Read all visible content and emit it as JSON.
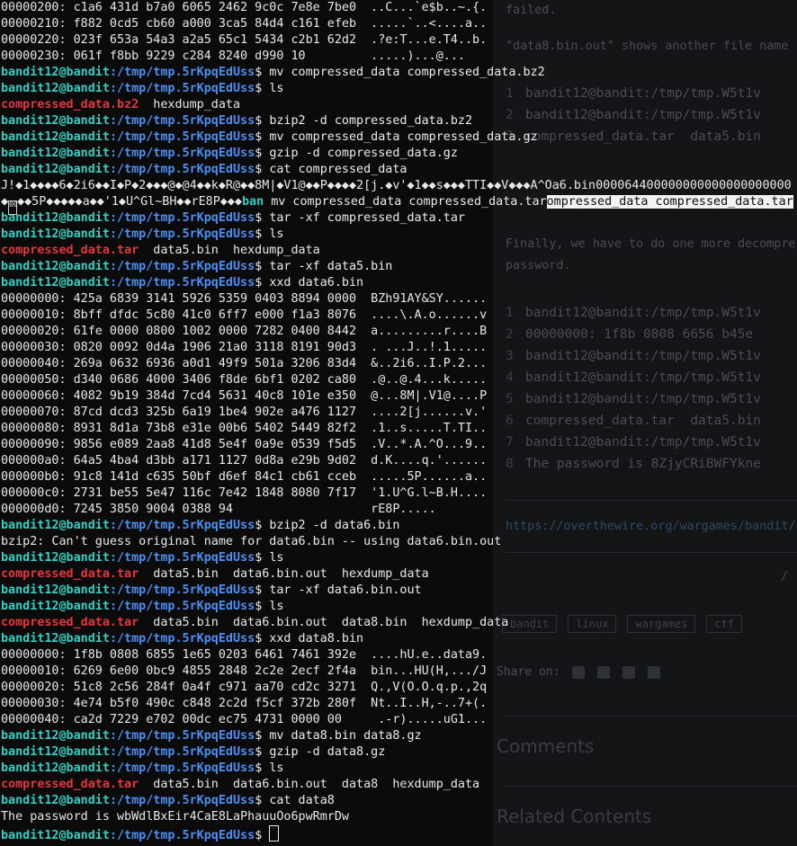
{
  "background_page": {
    "text_a": "failed.",
    "text_b": "\"data8.bin.out\" shows another file name",
    "code_block_1": [
      {
        "n": "1",
        "t": "bandit12@bandit:/tmp/tmp.W5t1v"
      },
      {
        "n": "2",
        "t": "bandit12@bandit:/tmp/tmp.W5t1v"
      },
      {
        "n": "3",
        "t": "compressed_data.tar  data5.bin"
      }
    ],
    "text_c": "Finally, we have to do one more decompre",
    "text_d": "password.",
    "code_block_2": [
      {
        "n": "1",
        "t": "bandit12@bandit:/tmp/tmp.W5t1v"
      },
      {
        "n": "2",
        "t": "00000000: 1f8b 0808 6656 b45e"
      },
      {
        "n": "3",
        "t": "bandit12@bandit:/tmp/tmp.W5t1v"
      },
      {
        "n": "4",
        "t": "bandit12@bandit:/tmp/tmp.W5t1v"
      },
      {
        "n": "5",
        "t": "bandit12@bandit:/tmp/tmp.W5t1v"
      },
      {
        "n": "6",
        "t": "compressed_data.tar  data5.bin"
      },
      {
        "n": "7",
        "t": "bandit12@bandit:/tmp/tmp.W5t1v"
      },
      {
        "n": "8",
        "t": "The password is 8ZjyCRiBWFYkne"
      }
    ],
    "link": "https://overthewire.org/wargames/bandit/",
    "slash": "/",
    "tags": [
      "bandit",
      "linux",
      "wargames",
      "ctf"
    ],
    "share_label": "Share on:",
    "comments_heading": "Comments",
    "related_heading": "Related Contents"
  },
  "prompt": {
    "user": "bandit12@bandit",
    "path": ":/tmp/tmp.5rKpqEdUss",
    "symbol": "$ "
  },
  "lines": [
    {
      "kind": "out",
      "text": "00000200: c1a6 431d b7a0 6065 2462 9c0c 7e8e 7be0  ..C...`e$b..~.{."
    },
    {
      "kind": "out",
      "text": "00000210: f882 0cd5 cb60 a000 3ca5 84d4 c161 efeb  .....`..<....a.."
    },
    {
      "kind": "out",
      "text": "00000220: 023f 653a 54a3 a2a5 65c1 5434 c2b1 62d2  .?e:T...e.T4..b."
    },
    {
      "kind": "out",
      "text": "00000230: 061f f8bb 9229 c284 8240 d990 10         .....)...@..."
    },
    {
      "kind": "cmd",
      "text": "mv compressed_data compressed_data.bz2"
    },
    {
      "kind": "cmd",
      "text": "ls"
    },
    {
      "kind": "ls",
      "red": "compressed_data.bz2",
      "rest": "  hexdump_data"
    },
    {
      "kind": "cmd",
      "text": "bzip2 -d compressed_data.bz2"
    },
    {
      "kind": "cmd",
      "text": "mv compressed_data compressed_data.gz"
    },
    {
      "kind": "cmd",
      "text": "gzip -d compressed_data.gz"
    },
    {
      "kind": "cmd",
      "text": "cat compressed_data"
    },
    {
      "kind": "out",
      "text": "J!◆1◆◆◆◆6◆2i6◆◆I◆P◆2◆◆◆@◆@4◆◆k◆R@◆◆8M|◆V1@◆◆P◆◆◆◆2[j.◆v'◆1◆◆s◆◆◆TTI◆◆V◆◆◆A^Oa6.bin000064400000000000000000000"
    },
    {
      "kind": "garbled",
      "pre": "◆",
      "box": "00",
      "mid": "◆◆5P◆◆◆◆◆a◆◆'1◆U^Gl~BH◆◆rE8P◆◆◆",
      "user2": "ban",
      "mid2": " mv compressed_data compressed_data.tar",
      "sel": "ompressed_data compressed_data.tar"
    },
    {
      "kind": "cmd",
      "text": "tar -xf compressed_data.tar"
    },
    {
      "kind": "cmd",
      "text": "ls"
    },
    {
      "kind": "ls",
      "red": "compressed_data.tar",
      "rest": "  data5.bin  hexdump_data"
    },
    {
      "kind": "cmd",
      "text": "tar -xf data5.bin"
    },
    {
      "kind": "cmd",
      "text": "xxd data6.bin"
    },
    {
      "kind": "out",
      "text": "00000000: 425a 6839 3141 5926 5359 0403 8894 0000  BZh91AY&SY......"
    },
    {
      "kind": "out",
      "text": "00000010: 8bff dfdc 5c80 41c0 6ff7 e000 f1a3 8076  ....\\.A.o......v"
    },
    {
      "kind": "out",
      "text": "00000020: 61fe 0000 0800 1002 0000 7282 0400 8442  a.........r....B"
    },
    {
      "kind": "out",
      "text": "00000030: 0820 0092 0d4a 1906 21a0 3118 8191 90d3  . ...J..!.1....."
    },
    {
      "kind": "out",
      "text": "00000040: 269a 0632 6936 a0d1 49f9 501a 3206 83d4  &..2i6..I.P.2..."
    },
    {
      "kind": "out",
      "text": "00000050: d340 0686 4000 3406 f8de 6bf1 0202 ca80  .@..@.4...k....."
    },
    {
      "kind": "out",
      "text": "00000060: 4082 9b19 384d 7cd4 5631 40c8 101e e350  @...8M|.V1@....P"
    },
    {
      "kind": "out",
      "text": "00000070: 87cd dcd3 325b 6a19 1be4 902e a476 1127  ....2[j......v.'"
    },
    {
      "kind": "out",
      "text": "00000080: 8931 8d1a 73b8 e31e 00b6 5402 5449 82f2  .1..s.....T.TI.."
    },
    {
      "kind": "out",
      "text": "00000090: 9856 e089 2aa8 41d8 5e4f 0a9e 0539 f5d5  .V..*.A.^O...9.."
    },
    {
      "kind": "out",
      "text": "000000a0: 64a5 4ba4 d3bb a171 1127 0d8a e29b 9d02  d.K....q.'......"
    },
    {
      "kind": "out",
      "text": "000000b0: 91c8 141d c635 50bf d6ef 84c1 cb61 cceb  .....5P......a.."
    },
    {
      "kind": "out",
      "text": "000000c0: 2731 be55 5e47 116c 7e42 1848 8080 7f17  '1.U^G.l~B.H...."
    },
    {
      "kind": "out",
      "text": "000000d0: 7245 3850 9004 0388 94                   rE8P....."
    },
    {
      "kind": "cmd",
      "text": "bzip2 -d data6.bin"
    },
    {
      "kind": "out",
      "text": "bzip2: Can't guess original name for data6.bin -- using data6.bin.out"
    },
    {
      "kind": "cmd",
      "text": "ls"
    },
    {
      "kind": "ls",
      "red": "compressed_data.tar",
      "rest": "  data5.bin  data6.bin.out  hexdump_data"
    },
    {
      "kind": "cmd",
      "text": "tar -xf data6.bin.out"
    },
    {
      "kind": "cmd",
      "text": "ls"
    },
    {
      "kind": "ls",
      "red": "compressed_data.tar",
      "rest": "  data5.bin  data6.bin.out  data8.bin  hexdump_data"
    },
    {
      "kind": "cmd",
      "text": "xxd data8.bin"
    },
    {
      "kind": "out",
      "text": "00000000: 1f8b 0808 6855 1e65 0203 6461 7461 392e  ....hU.e..data9."
    },
    {
      "kind": "out",
      "text": "00000010: 6269 6e00 0bc9 4855 2848 2c2e 2ecf 2f4a  bin...HU(H,.../J"
    },
    {
      "kind": "out",
      "text": "00000020: 51c8 2c56 284f 0a4f c971 aa70 cd2c 3271  Q.,V(O.O.q.p.,2q"
    },
    {
      "kind": "out",
      "text": "00000030: 4e74 b5f0 490c c848 2c2d f5cf 372b 280f  Nt..I..H,-..7+(."
    },
    {
      "kind": "out",
      "text": "00000040: ca2d 7229 e702 00dc ec75 4731 0000 00     .-r).....uG1..."
    },
    {
      "kind": "cmd",
      "text": "mv data8.bin data8.gz"
    },
    {
      "kind": "cmd",
      "text": "gzip -d data8.gz"
    },
    {
      "kind": "cmd",
      "text": "ls"
    },
    {
      "kind": "ls",
      "red": "compressed_data.tar",
      "rest": "  data5.bin  data6.bin.out  data8  hexdump_data"
    },
    {
      "kind": "cmd",
      "text": "cat data8"
    },
    {
      "kind": "out",
      "text": "The password is wbWdlBxEir4CaE8LaPhauuOo6pwRmrDw"
    },
    {
      "kind": "cursor",
      "text": ""
    }
  ]
}
